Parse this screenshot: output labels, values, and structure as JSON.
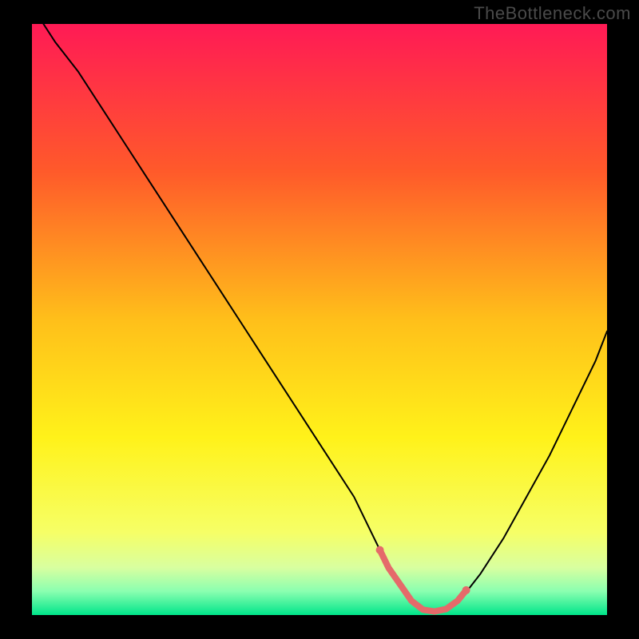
{
  "watermark": "TheBottleneck.com",
  "chart_data": {
    "type": "line",
    "title": "",
    "xlabel": "",
    "ylabel": "",
    "xlim": [
      0,
      100
    ],
    "ylim": [
      0,
      100
    ],
    "background_gradient": {
      "stops": [
        {
          "offset": 0.0,
          "color": "#ff1a55"
        },
        {
          "offset": 0.25,
          "color": "#ff5a2a"
        },
        {
          "offset": 0.5,
          "color": "#ffbf1a"
        },
        {
          "offset": 0.7,
          "color": "#fff21a"
        },
        {
          "offset": 0.86,
          "color": "#f6ff66"
        },
        {
          "offset": 0.92,
          "color": "#d8ffa0"
        },
        {
          "offset": 0.96,
          "color": "#8affb0"
        },
        {
          "offset": 1.0,
          "color": "#00e58a"
        }
      ]
    },
    "series": [
      {
        "name": "bottleneck-curve",
        "color": "#000000",
        "width": 2,
        "x": [
          2,
          4,
          8,
          12,
          16,
          20,
          24,
          28,
          32,
          36,
          40,
          44,
          48,
          52,
          56,
          60,
          62,
          64,
          66,
          68,
          70,
          72,
          74,
          78,
          82,
          86,
          90,
          94,
          98,
          100
        ],
        "y": [
          100,
          97,
          92,
          86,
          80,
          74,
          68,
          62,
          56,
          50,
          44,
          38,
          32,
          26,
          20,
          12,
          8,
          5,
          2,
          0.8,
          0.5,
          0.8,
          2,
          7,
          13,
          20,
          27,
          35,
          43,
          48
        ]
      },
      {
        "name": "sweet-spot-markers",
        "type": "scatter-line",
        "color": "#e56a6a",
        "width": 8,
        "x": [
          60.5,
          62,
          64,
          66,
          68,
          70,
          72,
          74,
          75.5
        ],
        "y": [
          11,
          8,
          5.2,
          2.4,
          0.9,
          0.6,
          1.0,
          2.4,
          4.2
        ]
      }
    ]
  }
}
